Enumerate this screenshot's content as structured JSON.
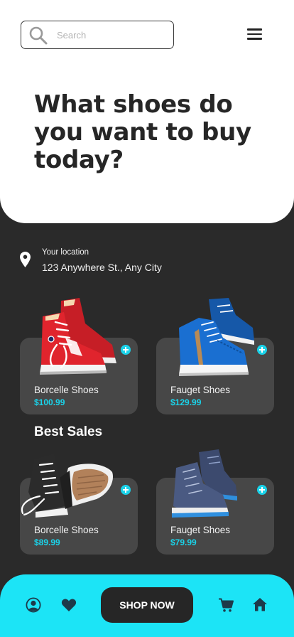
{
  "search": {
    "placeholder": "Search",
    "value": ""
  },
  "hero": {
    "headline": "What shoes do you want to buy today?"
  },
  "location": {
    "label": "Your location",
    "address": "123 Anywhere St., Any City"
  },
  "featured": [
    {
      "name": "Borcelle Shoes",
      "price": "$100.99"
    },
    {
      "name": "Fauget Shoes",
      "price": "$129.99"
    }
  ],
  "best_sales": {
    "title": "Best Sales",
    "items": [
      {
        "name": "Borcelle Shoes",
        "price": "$89.99"
      },
      {
        "name": "Fauget Shoes",
        "price": "$79.99"
      }
    ]
  },
  "bottom_nav": {
    "shop_now_label": "SHOP NOW",
    "icons": [
      "user-icon",
      "heart-icon",
      "cart-icon",
      "home-icon"
    ]
  },
  "colors": {
    "accent": "#1ce4f6",
    "price": "#1ad3ea",
    "background": "#2a2a2a",
    "card": "#474747"
  }
}
